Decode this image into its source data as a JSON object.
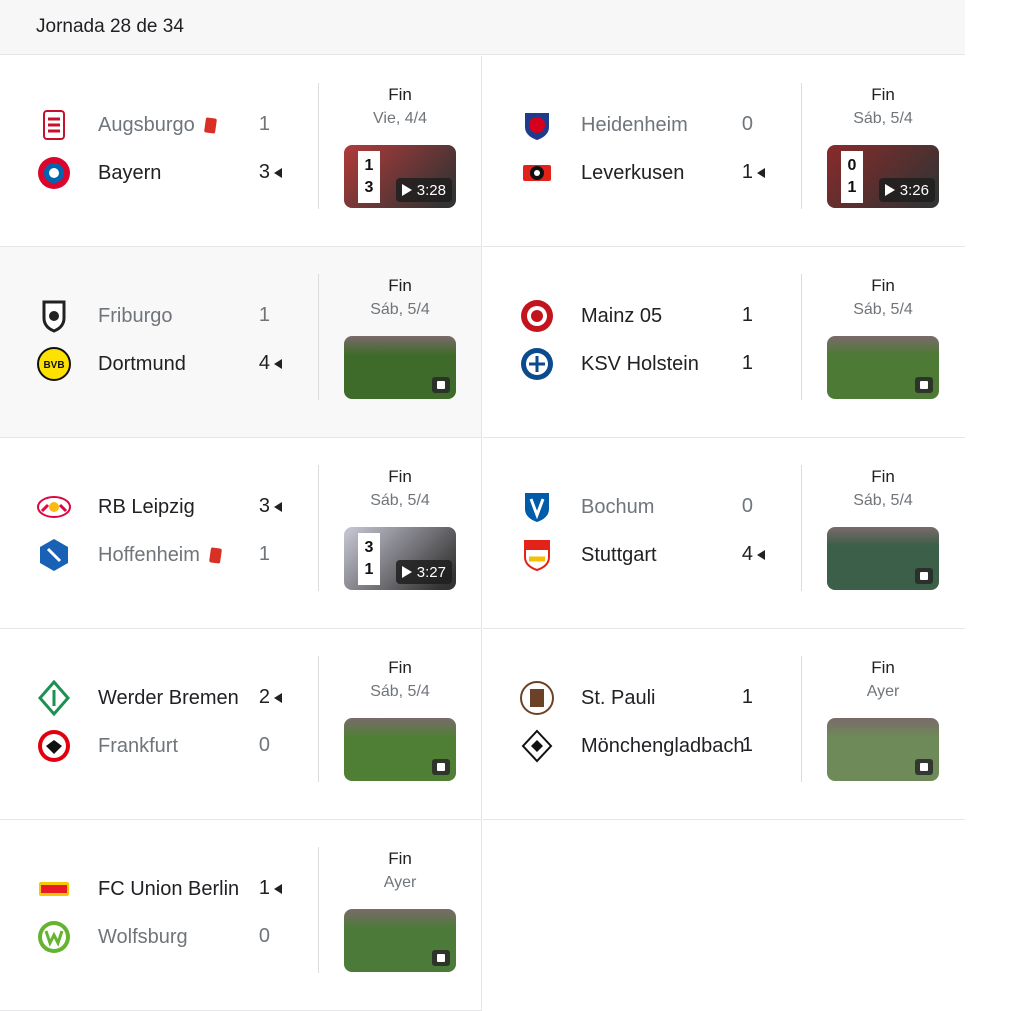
{
  "header": {
    "title": "Jornada 28 de 34"
  },
  "matches": [
    {
      "status": "Fin",
      "date": "Vie, 4/4",
      "home": {
        "name": "Augsburgo",
        "score": "1",
        "winner": false,
        "red_card": true,
        "logo": "augsburg-crest",
        "color": "#c8102e"
      },
      "away": {
        "name": "Bayern",
        "score": "3",
        "winner": true,
        "red_card": false,
        "logo": "bayern-crest",
        "color": "#dc052d"
      },
      "highlight": {
        "type": "video",
        "duration": "3:28",
        "score_top": "1",
        "score_bottom": "3",
        "scene_color": "#b23a3a"
      }
    },
    {
      "status": "Fin",
      "date": "Sáb, 5/4",
      "home": {
        "name": "Heidenheim",
        "score": "0",
        "winner": false,
        "red_card": false,
        "logo": "heidenheim-crest",
        "color": "#d6001c"
      },
      "away": {
        "name": "Leverkusen",
        "score": "1",
        "winner": true,
        "red_card": false,
        "logo": "leverkusen-crest",
        "color": "#e32219"
      },
      "highlight": {
        "type": "video",
        "duration": "3:26",
        "score_top": "0",
        "score_bottom": "1",
        "scene_color": "#8a2a2a"
      }
    },
    {
      "status": "Fin",
      "date": "Sáb, 5/4",
      "home": {
        "name": "Friburgo",
        "score": "1",
        "winner": false,
        "red_card": false,
        "logo": "freiburg-crest",
        "color": "#222222"
      },
      "away": {
        "name": "Dortmund",
        "score": "4",
        "winner": true,
        "red_card": false,
        "logo": "dortmund-crest",
        "color": "#fde100"
      },
      "highlight": {
        "type": "clip",
        "scene_color": "#3f6b2a"
      }
    },
    {
      "status": "Fin",
      "date": "Sáb, 5/4",
      "home": {
        "name": "Mainz 05",
        "score": "1",
        "winner": true,
        "red_card": false,
        "logo": "mainz-crest",
        "color": "#c3141e"
      },
      "away": {
        "name": "KSV Holstein",
        "score": "1",
        "winner": true,
        "red_card": false,
        "logo": "holstein-crest",
        "color": "#0a4a8f"
      },
      "highlight": {
        "type": "clip",
        "scene_color": "#4d7a35"
      }
    },
    {
      "status": "Fin",
      "date": "Sáb, 5/4",
      "home": {
        "name": "RB Leipzig",
        "score": "3",
        "winner": true,
        "red_card": false,
        "logo": "leipzig-crest",
        "color": "#dd0741"
      },
      "away": {
        "name": "Hoffenheim",
        "score": "1",
        "winner": false,
        "red_card": true,
        "logo": "hoffenheim-crest",
        "color": "#1961b5"
      },
      "highlight": {
        "type": "video",
        "duration": "3:27",
        "score_top": "3",
        "score_bottom": "1",
        "scene_color": "#c9c9d6"
      }
    },
    {
      "status": "Fin",
      "date": "Sáb, 5/4",
      "home": {
        "name": "Bochum",
        "score": "0",
        "winner": false,
        "red_card": false,
        "logo": "bochum-crest",
        "color": "#005ca9"
      },
      "away": {
        "name": "Stuttgart",
        "score": "4",
        "winner": true,
        "red_card": false,
        "logo": "stuttgart-crest",
        "color": "#e32219"
      },
      "highlight": {
        "type": "clip",
        "scene_color": "#3b5f48"
      }
    },
    {
      "status": "Fin",
      "date": "Sáb, 5/4",
      "home": {
        "name": "Werder Bremen",
        "score": "2",
        "winner": true,
        "red_card": false,
        "logo": "bremen-crest",
        "color": "#1d9053"
      },
      "away": {
        "name": "Frankfurt",
        "score": "0",
        "winner": false,
        "red_card": false,
        "logo": "frankfurt-crest",
        "color": "#e1000f"
      },
      "highlight": {
        "type": "clip",
        "scene_color": "#4f7f35"
      }
    },
    {
      "status": "Fin",
      "date": "Ayer",
      "home": {
        "name": "St. Pauli",
        "score": "1",
        "winner": true,
        "red_card": false,
        "logo": "stpauli-crest",
        "color": "#6b4226"
      },
      "away": {
        "name": "Mönchengladbach",
        "score": "1",
        "winner": true,
        "red_card": false,
        "logo": "gladbach-crest",
        "color": "#111111"
      },
      "highlight": {
        "type": "clip",
        "scene_color": "#6e8a58"
      }
    },
    {
      "status": "Fin",
      "date": "Ayer",
      "home": {
        "name": "FC Union Berlin",
        "score": "1",
        "winner": true,
        "red_card": false,
        "logo": "union-crest",
        "color": "#eb1923"
      },
      "away": {
        "name": "Wolfsburg",
        "score": "0",
        "winner": false,
        "red_card": false,
        "logo": "wolfsburg-crest",
        "color": "#65b32e"
      },
      "highlight": {
        "type": "clip",
        "scene_color": "#4c7a38"
      }
    }
  ]
}
